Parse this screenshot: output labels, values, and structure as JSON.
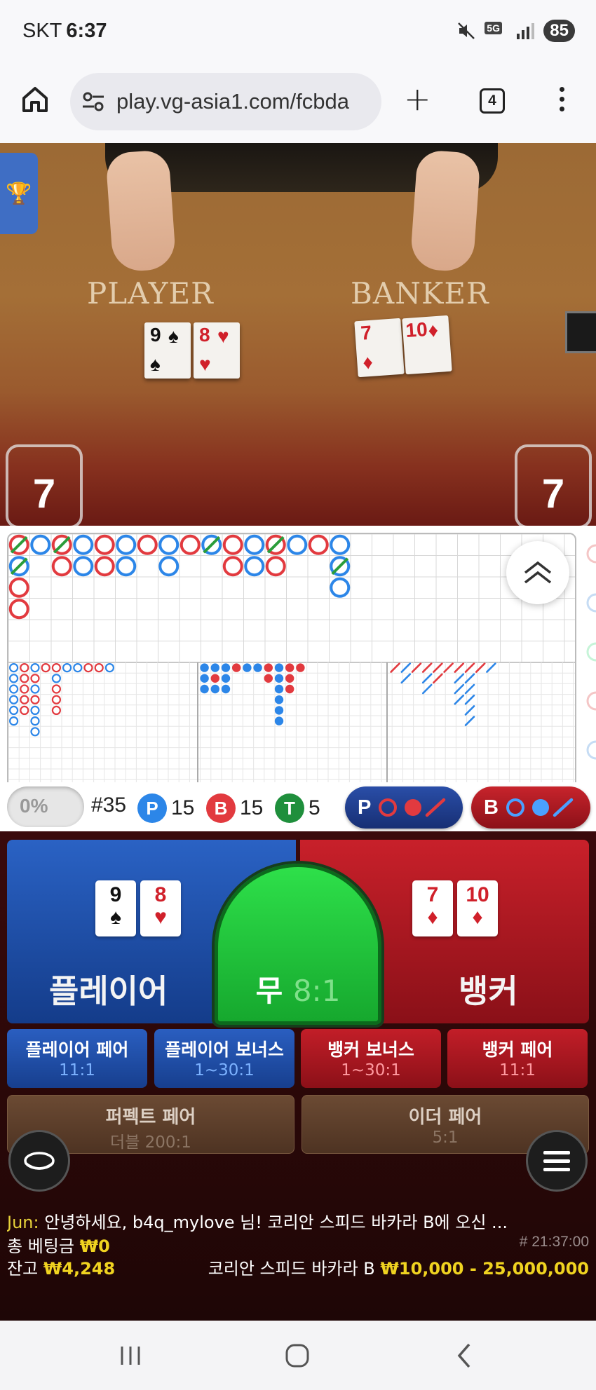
{
  "status_bar": {
    "carrier": "SKT",
    "time": "6:37",
    "network": "5G",
    "battery": "85",
    "icons": [
      "mute-icon",
      "5g-icon",
      "signal-icon",
      "battery-icon"
    ]
  },
  "browser": {
    "url": "play.vg-asia1.com/fcbda",
    "tab_count": "4",
    "icons": [
      "home-icon",
      "site-settings-icon",
      "plus-icon",
      "tabs-icon",
      "more-vert-icon"
    ]
  },
  "video": {
    "player_label": "PLAYER",
    "banker_label": "BANKER",
    "player_cards": [
      {
        "rank": "9",
        "suit": "♠",
        "color": "#111111"
      },
      {
        "rank": "8",
        "suit": "♥",
        "color": "#d0202a"
      }
    ],
    "banker_cards": [
      {
        "rank": "7",
        "suit": "♦",
        "color": "#d0202a"
      },
      {
        "rank": "10",
        "suit": "♦",
        "color": "#d0202a"
      }
    ],
    "player_score": "7",
    "banker_score": "7"
  },
  "roadmap": {
    "colors": {
      "player": "#2c86e8",
      "banker": "#e23a3f",
      "tie": "#2a9d3a"
    },
    "big_road": [
      [
        "B",
        "P",
        "B",
        "B"
      ],
      [
        "P"
      ],
      [
        "B",
        "B"
      ],
      [
        "P",
        "P"
      ],
      [
        "B",
        "B"
      ],
      [
        "P",
        "P"
      ],
      [
        "B"
      ],
      [
        "P",
        "P"
      ],
      [
        "B"
      ],
      [
        "P"
      ],
      [
        "B",
        "B"
      ],
      [
        "P",
        "P"
      ],
      [
        "B",
        "B"
      ],
      [
        "P"
      ],
      [
        "B"
      ],
      [
        "P",
        "P",
        "P"
      ]
    ],
    "tie_marks": [
      [
        0,
        0
      ],
      [
        0,
        1
      ],
      [
        2,
        0
      ],
      [
        9,
        0
      ],
      [
        12,
        0
      ],
      [
        15,
        1
      ]
    ]
  },
  "stats": {
    "percent": "0%",
    "round": "#35",
    "player_letter": "P",
    "player_count": "15",
    "banker_letter": "B",
    "banker_count": "15",
    "tie_letter": "T",
    "tie_count": "5",
    "player_predict_label": "P",
    "banker_predict_label": "B"
  },
  "betting": {
    "player_label": "플레이어",
    "banker_label": "뱅커",
    "tie_label": "무",
    "tie_odds": "8:1",
    "player_cards": [
      {
        "rank": "9",
        "suit": "♠",
        "color": "#111111"
      },
      {
        "rank": "8",
        "suit": "♥",
        "color": "#d0202a"
      }
    ],
    "banker_cards": [
      {
        "rank": "7",
        "suit": "♦",
        "color": "#d0202a"
      },
      {
        "rank": "10",
        "suit": "♦",
        "color": "#d0202a"
      }
    ],
    "side_bets": [
      {
        "title": "플레이어 페어",
        "odds": "11:1"
      },
      {
        "title": "플레이어 보너스",
        "odds": "1~30:1"
      },
      {
        "title": "뱅커 보너스",
        "odds": "1~30:1"
      },
      {
        "title": "뱅커 페어",
        "odds": "11:1"
      }
    ],
    "perfect_pair": {
      "title": "퍼펙트 페어",
      "odds": "더블 200:1"
    },
    "either_pair": {
      "title": "이더 페어",
      "odds": "5:1"
    }
  },
  "chat": {
    "user": "Jun:",
    "message": "안녕하세요, b4q_mylove 님! 코리안 스피드 바카라 B에 오신 ..."
  },
  "info": {
    "total_bet_label": "총 베팅금",
    "total_bet_value": "₩0",
    "round_time": "# 21:37:00",
    "balance_label": "잔고",
    "balance_value": "₩4,248",
    "table_name": "코리안 스피드 바카라 B",
    "limits": "₩10,000 - 25,000,000"
  }
}
